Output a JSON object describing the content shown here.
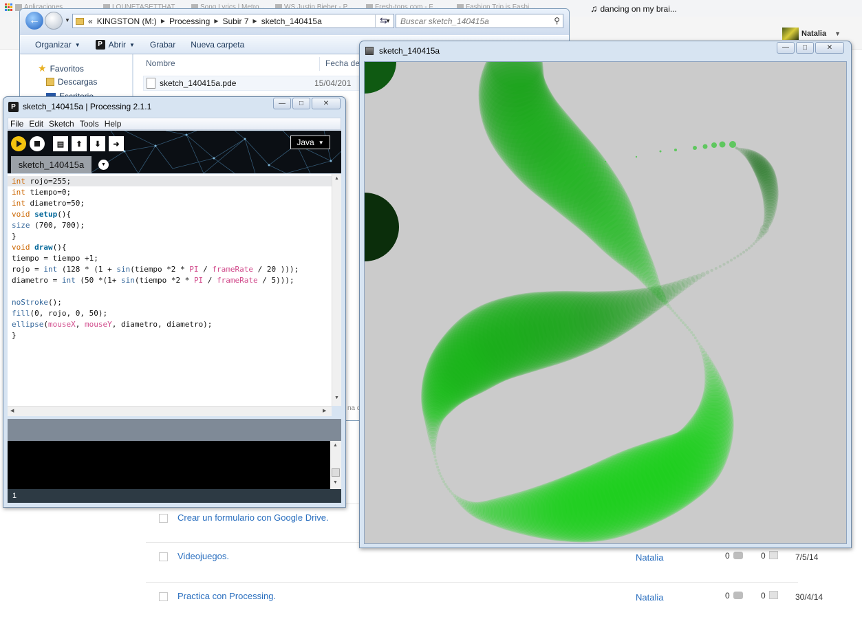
{
  "browser": {
    "bookmarks": [
      {
        "label": "Aplicaciones"
      },
      {
        "label": "LOUNETASETTHAT..."
      },
      {
        "label": "Song Lyrics | Metro..."
      },
      {
        "label": "WS Justin Bieber - P..."
      },
      {
        "label": "Fresh-tops.com - F..."
      },
      {
        "label": "Fashion Trip is Fashi..."
      }
    ],
    "music_bookmark": "dancing on my brai...",
    "user_name": "Natalia",
    "posts": [
      {
        "title": "Crear un formulario con Google Drive.",
        "author": "",
        "comments": "",
        "views": "",
        "date": ""
      },
      {
        "title": "Videojuegos.",
        "author": "Natalia",
        "comments": "0",
        "views": "0",
        "date": "7/5/14"
      },
      {
        "title": "Practica con Processing.",
        "author": "Natalia",
        "comments": "0",
        "views": "0",
        "date": "30/4/14"
      }
    ]
  },
  "explorer": {
    "breadcrumb": [
      "KINGSTON (M:)",
      "Processing",
      "Subir 7",
      "sketch_140415a"
    ],
    "breadcrumb_prefix": "«",
    "search_placeholder": "Buscar sketch_140415a",
    "commands": {
      "organize": "Organizar",
      "open": "Abrir",
      "burn": "Grabar",
      "new_folder": "Nueva carpeta"
    },
    "nav": {
      "favorites": "Favoritos",
      "downloads": "Descargas",
      "desktop": "Escritorio"
    },
    "columns": {
      "name": "Nombre",
      "date": "Fecha de"
    },
    "file": {
      "name": "sketch_140415a.pde",
      "date": "15/04/201"
    },
    "truncated_text": "na d"
  },
  "pde": {
    "title": "sketch_140415a | Processing 2.1.1",
    "menu": [
      "File",
      "Edit",
      "Sketch",
      "Tools",
      "Help"
    ],
    "mode": "Java",
    "tab": "sketch_140415a",
    "line_number": "1"
  },
  "sketch_window": {
    "title": "sketch_140415a",
    "size": [
      700,
      700
    ],
    "background": "#cbcbcb",
    "dark_circles": [
      "#0b2e0b",
      "#0f5a12"
    ],
    "trail_color": "#18c418"
  },
  "window_buttons": {
    "minimize": "—",
    "maximize": "□",
    "close": "✕"
  },
  "colors": {
    "keyword": "#cc6600",
    "function": "#006699",
    "builtin": "#d14a8b",
    "run": "#f4c30e"
  }
}
